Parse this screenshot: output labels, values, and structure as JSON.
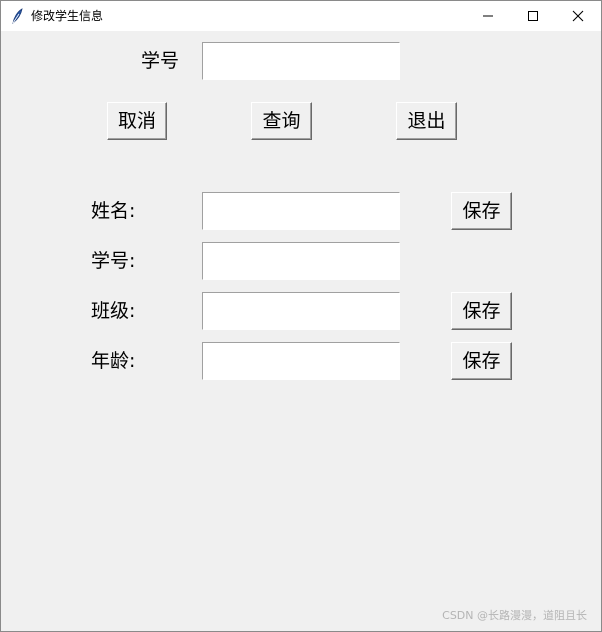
{
  "window": {
    "title": "修改学生信息",
    "icon": "feather-icon"
  },
  "query": {
    "student_id_label": "学号",
    "student_id_value": ""
  },
  "actions": {
    "cancel_label": "取消",
    "search_label": "查询",
    "exit_label": "退出"
  },
  "form": {
    "name_label": "姓名:",
    "name_value": "",
    "id_label": "学号:",
    "id_value": "",
    "class_label": "班级:",
    "class_value": "",
    "age_label": "年龄:",
    "age_value": "",
    "save_label": "保存"
  },
  "watermark": "CSDN @长路漫漫，道阻且长"
}
